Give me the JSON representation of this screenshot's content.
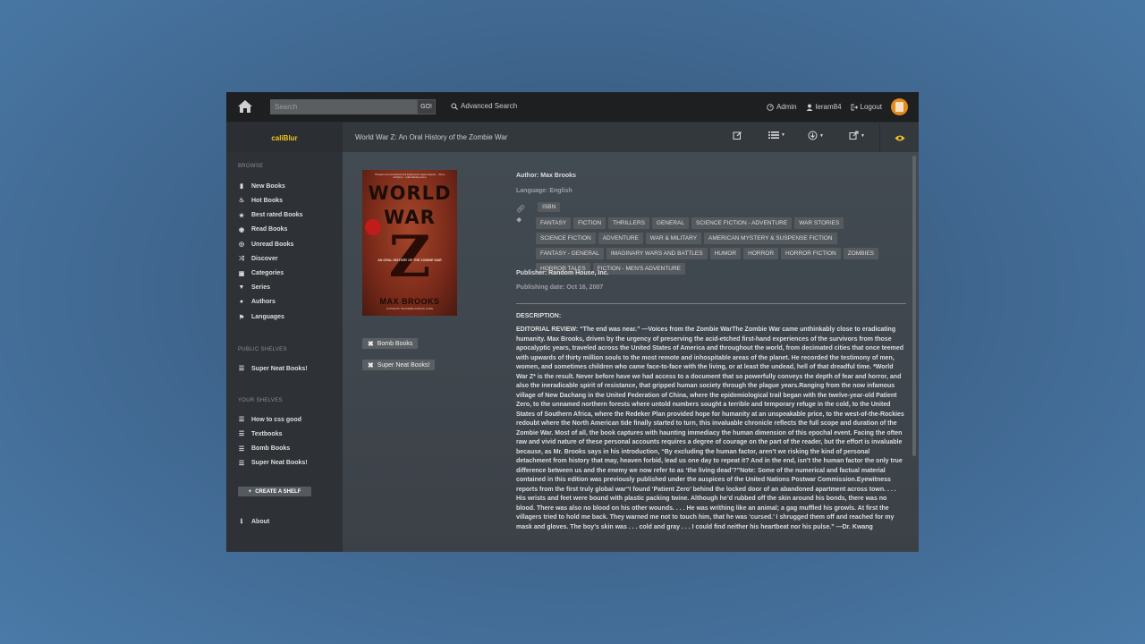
{
  "topbar": {
    "search_placeholder": "Search",
    "go_label": "GO!",
    "advanced_search": "Advanced Search",
    "admin": "Admin",
    "user": "leram84",
    "logout": "Logout"
  },
  "secondbar": {
    "brand": "caliBlur",
    "book_title": "World War Z: An Oral History of the Zombie War"
  },
  "sidebar": {
    "browse_head": "BROWSE",
    "browse": [
      {
        "label": "New Books",
        "icon": "book-icon"
      },
      {
        "label": "Hot Books",
        "icon": "fire-icon"
      },
      {
        "label": "Best rated Books",
        "icon": "star-icon"
      },
      {
        "label": "Read Books",
        "icon": "eye-icon"
      },
      {
        "label": "Unread Books",
        "icon": "eye-slash-icon"
      },
      {
        "label": "Discover",
        "icon": "random-icon"
      },
      {
        "label": "Categories",
        "icon": "inbox-icon"
      },
      {
        "label": "Series",
        "icon": "bookmark-icon"
      },
      {
        "label": "Authors",
        "icon": "user-icon"
      },
      {
        "label": "Languages",
        "icon": "flag-icon"
      }
    ],
    "public_head": "PUBLIC SHELVES",
    "public_shelves": [
      "Super Neat Books!"
    ],
    "your_head": "YOUR SHELVES",
    "your_shelves": [
      "How to css good",
      "Textbooks",
      "Bomb Books",
      "Super Neat Books!"
    ],
    "create_shelf": "CREATE A SHELF",
    "about": "About"
  },
  "book": {
    "cover": {
      "tagline": "\"Prepare to be entertained and frightened in equal measure ... this is terrifying\" —Julia Mackay Home",
      "title_line1": "WORLD",
      "title_line2": "WAR",
      "title_z": "Z",
      "subtitle": "AN ORAL HISTORY OF THE ZOMBIE WAR",
      "author": "MAX BROOKS",
      "footer": "AUTHOR OF THE ZOMBIE SURVIVAL GUIDE"
    },
    "shelves": [
      "Bomb Books",
      "Super Neat Books!"
    ],
    "author_label": "Author:",
    "author": "Max Brooks",
    "language": "Language: English",
    "identifier": "ISBN",
    "tags": [
      "FANTASY",
      "FICTION",
      "THRILLERS",
      "GENERAL",
      "SCIENCE FICTION - ADVENTURE",
      "WAR STORIES",
      "SCIENCE FICTION",
      "ADVENTURE",
      "WAR & MILITARY",
      "AMERICAN MYSTERY & SUSPENSE FICTION",
      "FANTASY - GENERAL",
      "IMAGINARY WARS AND BATTLES",
      "HUMOR",
      "HORROR",
      "HORROR FICTION",
      "ZOMBIES",
      "HORROR TALES",
      "FICTION - MEN'S ADVENTURE"
    ],
    "publisher": "Publisher: Random House, Inc.",
    "pubdate": "Publishing date: Oct 16, 2007",
    "description_head": "DESCRIPTION:",
    "description": "EDITORIAL REVIEW: “The end was near.” —Voices from the Zombie WarThe Zombie War came unthinkably close to eradicating humanity. Max Brooks, driven by the urgency of preserving the acid-etched first-hand experiences of the survivors from those apocalyptic years, traveled across the United States of America and throughout the world, from decimated cities that once teemed with upwards of thirty million souls to the most remote and inhospitable areas of the planet. He recorded the testimony of men, women, and sometimes children who came face-to-face with the living, or at least the undead, hell of that dreadful time. *World War Z* is the result. Never before have we had access to a document that so powerfully conveys the depth of fear and horror, and also the ineradicable spirit of resistance, that gripped human society through the plague years.Ranging from the now infamous village of New Dachang in the United Federation of China, where the epidemiological trail began with the twelve-year-old Patient Zero, to the unnamed northern forests where untold numbers sought a terrible and temporary refuge in the cold, to the United States of Southern Africa, where the Redeker Plan provided hope for humanity at an unspeakable price, to the west-of-the-Rockies redoubt where the North American tide finally started to turn, this invaluable chronicle reflects the full scope and duration of the Zombie War. Most of all, the book captures with haunting immediacy the human dimension of this epochal event. Facing the often raw and vivid nature of these personal accounts requires a degree of courage on the part of the reader, but the effort is invaluable because, as Mr. Brooks says in his introduction, “By excluding the human factor, aren’t we risking the kind of personal detachment from history that may, heaven forbid, lead us one day to repeat it? And in the end, isn’t the human factor the only true difference between us and the enemy we now refer to as ‘the living dead’?”Note: Some of the numerical and factual material contained in this edition was previously published under the auspices of the United Nations Postwar Commission.Eyewitness reports from the first truly global war“I found ‘Patient Zero’ behind the locked door of an abandoned apartment across town. . . . His wrists and feet were bound with plastic packing twine. Although he’d rubbed off the skin around his bonds, there was no blood. There was also no blood on his other wounds. . . . He was writhing like an animal; a gag muffled his growls. At first the villagers tried to hold me back. They warned me not to touch him, that he was ‘cursed.’ I shrugged them off and reached for my mask and gloves. The boy’s skin was . . . cold and gray . . . I could find neither his heartbeat nor his pulse.” —Dr. Kwang"
  },
  "colors": {
    "brand": "#f0c419",
    "accent": "#e58a1f"
  }
}
